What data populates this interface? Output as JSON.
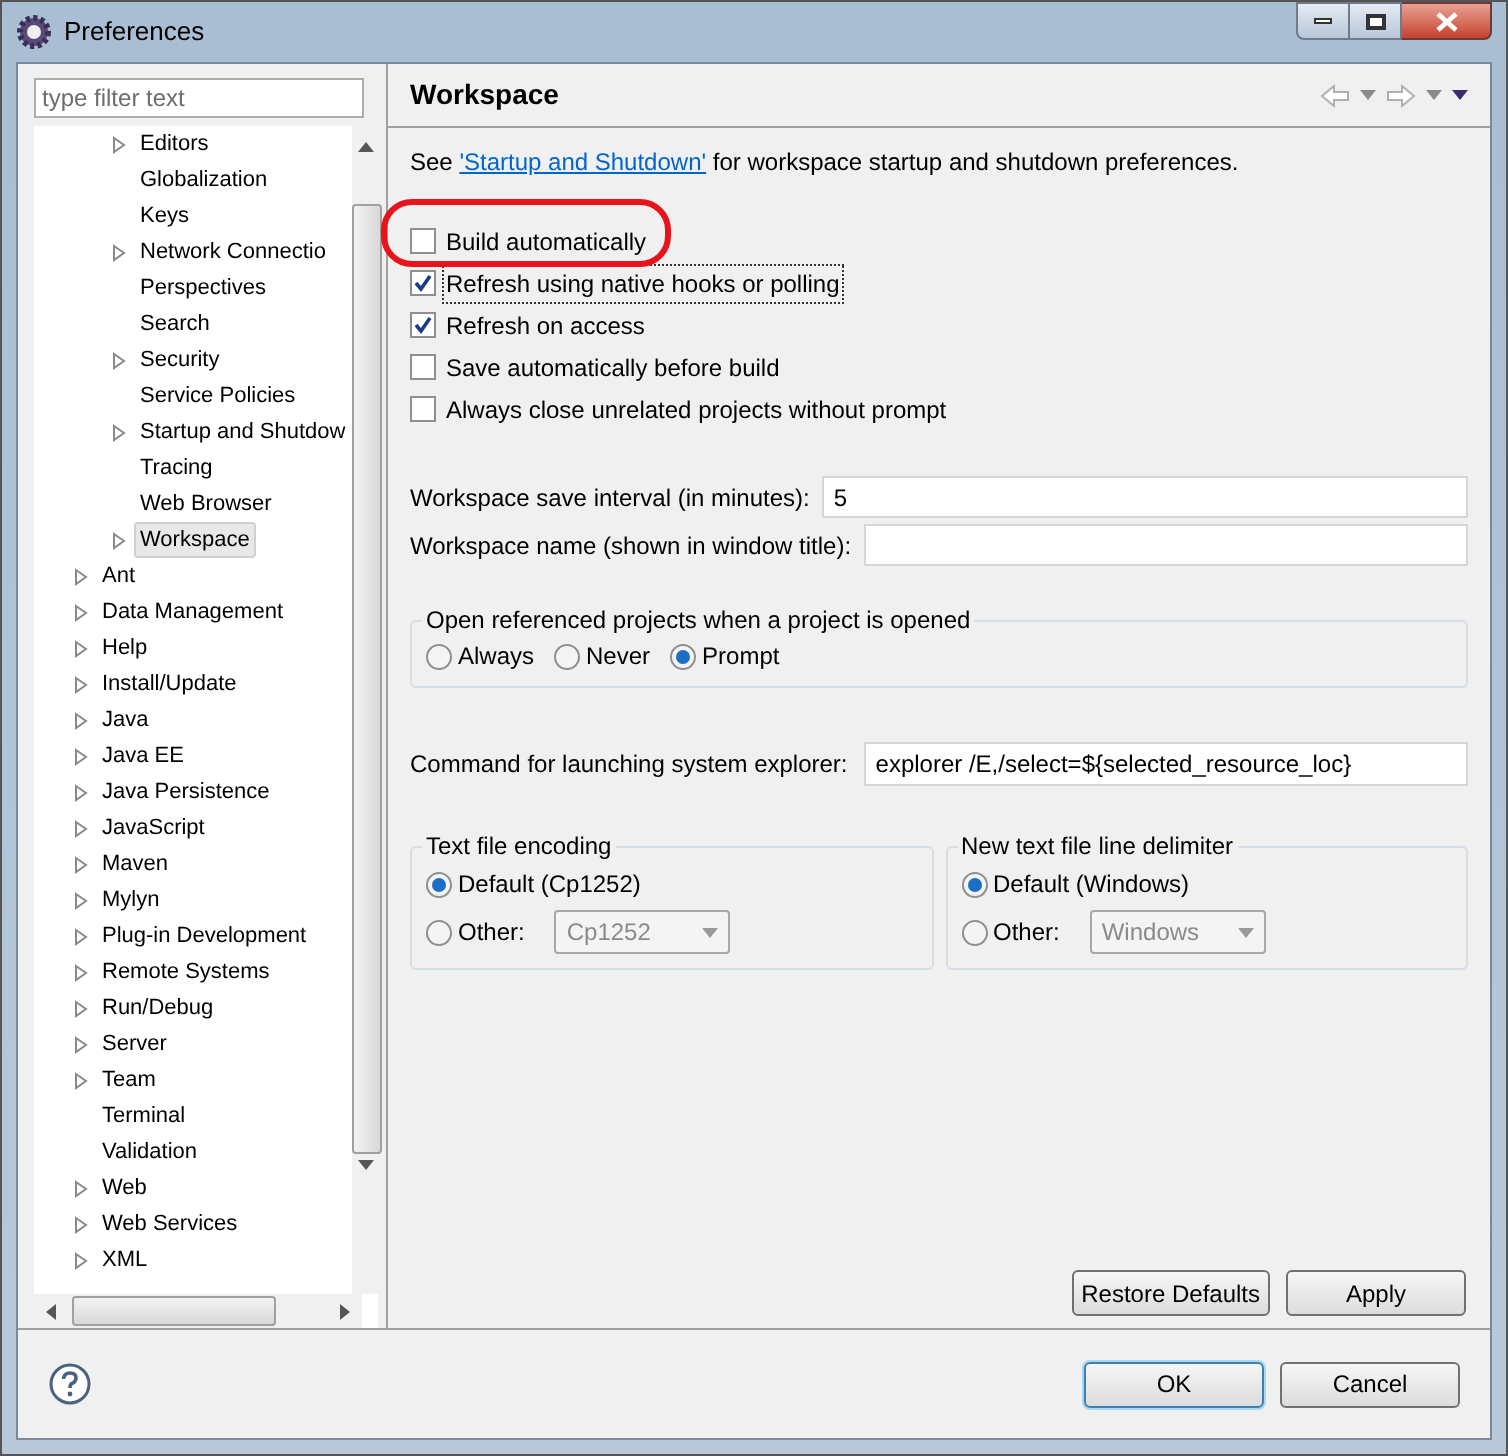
{
  "window": {
    "title": "Preferences"
  },
  "filter": {
    "placeholder": "type filter text"
  },
  "tree": [
    {
      "children": [
        {
          "label": "Editors",
          "expandable": true,
          "selected": false
        },
        {
          "label": "Globalization",
          "expandable": false,
          "selected": false
        },
        {
          "label": "Keys",
          "expandable": false,
          "selected": false
        },
        {
          "label": "Network Connectio",
          "expandable": true,
          "selected": false
        },
        {
          "label": "Perspectives",
          "expandable": false,
          "selected": false
        },
        {
          "label": "Search",
          "expandable": false,
          "selected": false
        },
        {
          "label": "Security",
          "expandable": true,
          "selected": false
        },
        {
          "label": "Service Policies",
          "expandable": false,
          "selected": false
        },
        {
          "label": "Startup and Shutdow",
          "expandable": true,
          "selected": false
        },
        {
          "label": "Tracing",
          "expandable": false,
          "selected": false
        },
        {
          "label": "Web Browser",
          "expandable": false,
          "selected": false
        },
        {
          "label": "Workspace",
          "expandable": true,
          "selected": true
        }
      ]
    },
    {
      "label": "Ant",
      "expandable": true,
      "selected": false
    },
    {
      "label": "Data Management",
      "expandable": true,
      "selected": false
    },
    {
      "label": "Help",
      "expandable": true,
      "selected": false
    },
    {
      "label": "Install/Update",
      "expandable": true,
      "selected": false
    },
    {
      "label": "Java",
      "expandable": true,
      "selected": false
    },
    {
      "label": "Java EE",
      "expandable": true,
      "selected": false
    },
    {
      "label": "Java Persistence",
      "expandable": true,
      "selected": false
    },
    {
      "label": "JavaScript",
      "expandable": true,
      "selected": false
    },
    {
      "label": "Maven",
      "expandable": true,
      "selected": false
    },
    {
      "label": "Mylyn",
      "expandable": true,
      "selected": false
    },
    {
      "label": "Plug-in Development",
      "expandable": true,
      "selected": false
    },
    {
      "label": "Remote Systems",
      "expandable": true,
      "selected": false
    },
    {
      "label": "Run/Debug",
      "expandable": true,
      "selected": false
    },
    {
      "label": "Server",
      "expandable": true,
      "selected": false
    },
    {
      "label": "Team",
      "expandable": true,
      "selected": false
    },
    {
      "label": "Terminal",
      "expandable": false,
      "selected": false
    },
    {
      "label": "Validation",
      "expandable": false,
      "selected": false
    },
    {
      "label": "Web",
      "expandable": true,
      "selected": false
    },
    {
      "label": "Web Services",
      "expandable": true,
      "selected": false
    },
    {
      "label": "XML",
      "expandable": true,
      "selected": false
    }
  ],
  "page": {
    "title": "Workspace",
    "intro_before": "See",
    "intro_link": "'Startup and Shutdown'",
    "intro_after": "for workspace startup and shutdown preferences."
  },
  "checkboxes": [
    {
      "label": "Build automatically",
      "checked": false,
      "focused": false
    },
    {
      "label": "Refresh using native hooks or polling",
      "checked": true,
      "focused": true
    },
    {
      "label": "Refresh on access",
      "checked": true,
      "focused": false
    },
    {
      "label": "Save automatically before build",
      "checked": false,
      "focused": false
    },
    {
      "label": "Always close unrelated projects without prompt",
      "checked": false,
      "focused": false
    }
  ],
  "fields": [
    {
      "label": "Workspace save interval (in minutes):",
      "value": "5"
    },
    {
      "label": "Workspace name (shown in window title):"
    }
  ],
  "open_projects": {
    "title": "Open referenced projects when a project is opened",
    "options": [
      {
        "label": "Always",
        "selected": false
      },
      {
        "label": "Never",
        "selected": false
      },
      {
        "label": "Prompt",
        "selected": true
      }
    ]
  },
  "command": {
    "label": "Command for launching system explorer:",
    "value": "explorer /E,/select=${selected_resource_loc}"
  },
  "groups": [
    {
      "title": "Text file encoding",
      "options": [
        {
          "kind": "plain",
          "label": "Default (Cp1252)",
          "selected": true
        },
        {
          "kind": "combo",
          "label": "Other:",
          "selected": false,
          "value": "Cp1252"
        }
      ]
    },
    {
      "title": "New text file line delimiter",
      "options": [
        {
          "kind": "plain",
          "label": "Default (Windows)",
          "selected": true
        },
        {
          "kind": "combo",
          "label": "Other:",
          "selected": false,
          "value": "Windows"
        }
      ]
    }
  ],
  "page_buttons": [
    "Restore Defaults",
    "Apply"
  ],
  "dialog_buttons": [
    {
      "label": "OK",
      "default": true
    },
    {
      "label": "Cancel",
      "default": false
    }
  ]
}
